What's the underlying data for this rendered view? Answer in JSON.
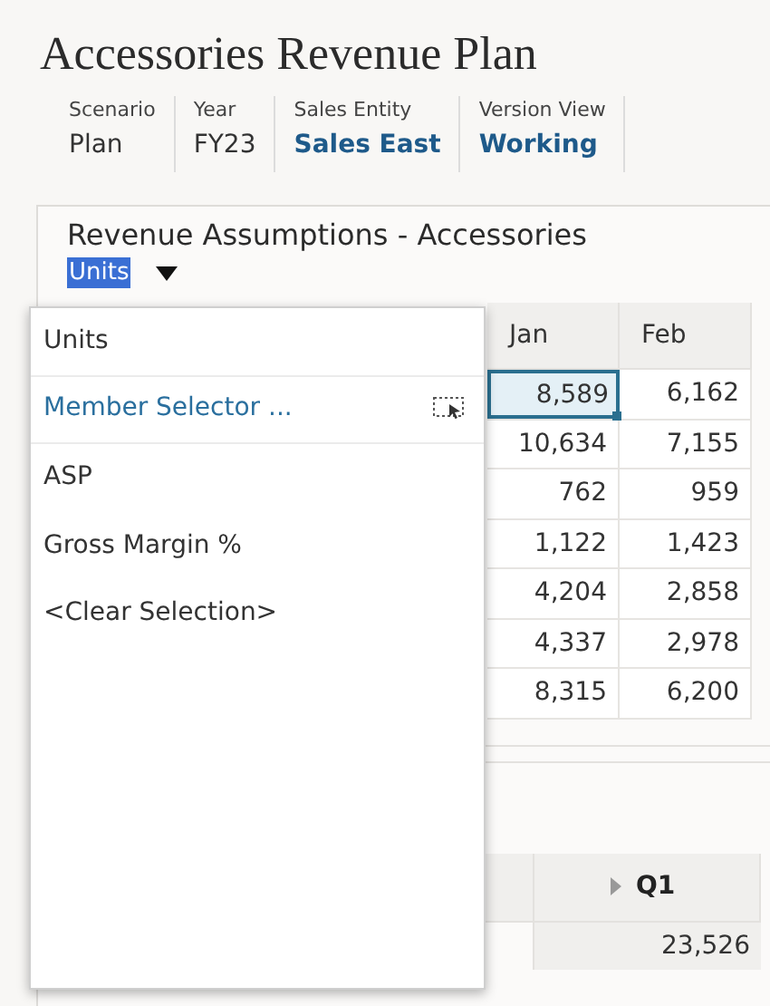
{
  "title": "Accessories Revenue Plan",
  "pov": [
    {
      "label": "Scenario",
      "value": "Plan",
      "link": false
    },
    {
      "label": "Year",
      "value": "FY23",
      "link": false
    },
    {
      "label": "Sales Entity",
      "value": "Sales East",
      "link": true
    },
    {
      "label": "Version View",
      "value": "Working",
      "link": true
    }
  ],
  "panel": {
    "title": "Revenue Assumptions - Accessories",
    "selector": "Units"
  },
  "grid": {
    "columns": [
      "Jan",
      "Feb"
    ],
    "rows": [
      [
        {
          "value": "8,589",
          "selected": true
        },
        {
          "value": "6,162",
          "selected": false
        }
      ],
      [
        {
          "value": "10,634",
          "selected": false
        },
        {
          "value": "7,155",
          "selected": false
        }
      ],
      [
        {
          "value": "762",
          "selected": false
        },
        {
          "value": "959",
          "selected": false
        }
      ],
      [
        {
          "value": "1,122",
          "selected": false
        },
        {
          "value": "1,423",
          "selected": false
        }
      ],
      [
        {
          "value": "4,204",
          "selected": false
        },
        {
          "value": "2,858",
          "selected": false
        }
      ],
      [
        {
          "value": "4,337",
          "selected": false
        },
        {
          "value": "2,978",
          "selected": false
        }
      ],
      [
        {
          "value": "8,315",
          "selected": false
        },
        {
          "value": "6,200",
          "selected": false
        }
      ]
    ]
  },
  "summary_grid": {
    "column": "Q1",
    "value": "23,526"
  },
  "dropdown": [
    {
      "label": "Units",
      "kind": "option"
    },
    {
      "label": "Member Selector ...",
      "kind": "action"
    },
    {
      "label": "ASP",
      "kind": "option"
    },
    {
      "label": "Gross Margin %",
      "kind": "option"
    },
    {
      "label": "<Clear Selection>",
      "kind": "option"
    }
  ]
}
